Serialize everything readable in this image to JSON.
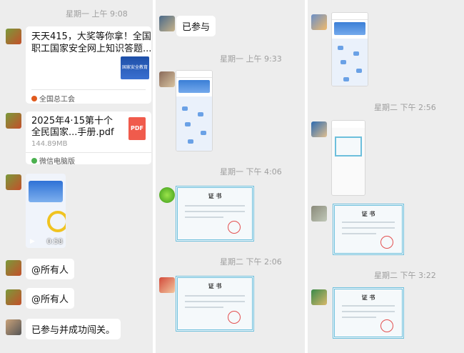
{
  "panel1": {
    "timestamp": "星期一 上午 9:08",
    "link_card": {
      "title": "天天415，大奖等你拿！全国职工国家安全网上知识答题...",
      "thumb_text": "国家安全教育",
      "source": "全国总工会"
    },
    "file_card": {
      "name": "2025年4·15第十个全民国家...手册.pdf",
      "size": "144.89MB",
      "icon": "PDF",
      "source": "微信电脑版"
    },
    "video": {
      "duration": "0:58"
    },
    "messages": [
      "@所有人",
      "@所有人",
      "已参与并成功闯关。"
    ]
  },
  "panel2": {
    "top_message": "已参与",
    "timestamps": [
      "星期一 上午 9:33",
      "星期一 下午 4:06",
      "星期二 下午 2:06"
    ],
    "cert_title": "证 书"
  },
  "panel3": {
    "timestamps": [
      "星期二 下午 2:56",
      "星期二 下午 3:22"
    ],
    "cert_title": "证 书"
  }
}
